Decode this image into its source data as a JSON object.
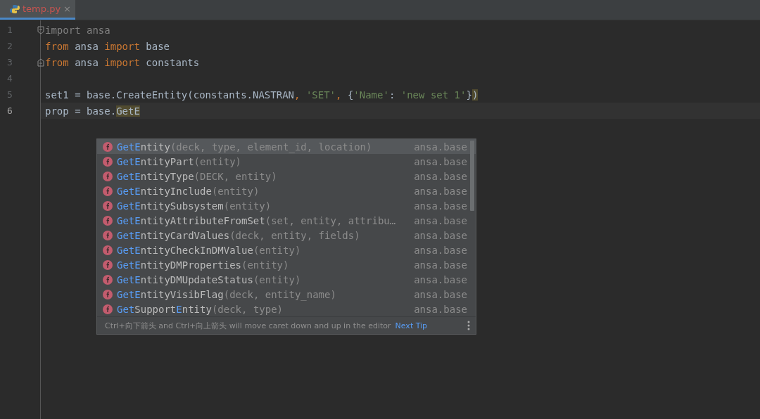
{
  "tabs": [
    {
      "label": "temp.py",
      "close": "×",
      "selected": true
    }
  ],
  "editor": {
    "lines": [
      {
        "number": "1",
        "current": false,
        "fold_start": true,
        "fold_end": false,
        "tokens": [
          {
            "text": "import ansa",
            "kind": "unused"
          }
        ]
      },
      {
        "number": "2",
        "current": false,
        "fold_start": false,
        "fold_end": false,
        "tokens": [
          {
            "text": "from",
            "kind": "keyword"
          },
          {
            "text": " ansa ",
            "kind": "plain"
          },
          {
            "text": "import",
            "kind": "keyword"
          },
          {
            "text": " base",
            "kind": "plain"
          }
        ]
      },
      {
        "number": "3",
        "current": false,
        "fold_start": false,
        "fold_end": true,
        "tokens": [
          {
            "text": "from",
            "kind": "keyword"
          },
          {
            "text": " ansa ",
            "kind": "plain"
          },
          {
            "text": "import",
            "kind": "keyword"
          },
          {
            "text": " constants",
            "kind": "plain"
          }
        ]
      },
      {
        "number": "4",
        "current": false,
        "fold_start": false,
        "fold_end": false
      },
      {
        "number": "5",
        "current": false,
        "fold_start": false,
        "fold_end": false,
        "tokens": [
          {
            "text": "set1 = base.CreateEntity(constants.NASTRAN",
            "kind": "plain"
          },
          {
            "text": ", ",
            "kind": "keyword"
          },
          {
            "text": "'SET'",
            "kind": "string"
          },
          {
            "text": ", ",
            "kind": "keyword"
          },
          {
            "text": "{",
            "kind": "plain"
          },
          {
            "text": "'Name'",
            "kind": "string"
          },
          {
            "text": ": ",
            "kind": "plain"
          },
          {
            "text": "'new set 1'",
            "kind": "string"
          },
          {
            "text": "}",
            "kind": "plain"
          },
          {
            "text": ")",
            "kind": "plain",
            "highlight": true
          }
        ]
      },
      {
        "number": "6",
        "current": true,
        "fold_start": false,
        "fold_end": false,
        "tokens": [
          {
            "text": "prop = base.",
            "kind": "plain"
          },
          {
            "text": "GetE",
            "kind": "plain",
            "highlight": true
          }
        ]
      }
    ]
  },
  "completion": {
    "items": [
      {
        "selected": true,
        "name_parts": [
          {
            "text": "GetE",
            "match": true
          },
          {
            "text": "ntity",
            "match": false
          }
        ],
        "params": "(deck, type, element_id, location)",
        "module": "ansa.base"
      },
      {
        "selected": false,
        "name_parts": [
          {
            "text": "GetE",
            "match": true
          },
          {
            "text": "ntityPart",
            "match": false
          }
        ],
        "params": "(entity)",
        "module": "ansa.base"
      },
      {
        "selected": false,
        "name_parts": [
          {
            "text": "GetE",
            "match": true
          },
          {
            "text": "ntityType",
            "match": false
          }
        ],
        "params": "(DECK, entity)",
        "module": "ansa.base"
      },
      {
        "selected": false,
        "name_parts": [
          {
            "text": "GetE",
            "match": true
          },
          {
            "text": "ntityInclude",
            "match": false
          }
        ],
        "params": "(entity)",
        "module": "ansa.base"
      },
      {
        "selected": false,
        "name_parts": [
          {
            "text": "GetE",
            "match": true
          },
          {
            "text": "ntitySubsystem",
            "match": false
          }
        ],
        "params": "(entity)",
        "module": "ansa.base"
      },
      {
        "selected": false,
        "name_parts": [
          {
            "text": "GetE",
            "match": true
          },
          {
            "text": "ntityAttributeFromSet",
            "match": false
          }
        ],
        "params": "(set, entity, attribu…",
        "module": "ansa.base"
      },
      {
        "selected": false,
        "name_parts": [
          {
            "text": "GetE",
            "match": true
          },
          {
            "text": "ntityCardValues",
            "match": false
          }
        ],
        "params": "(deck, entity, fields)",
        "module": "ansa.base"
      },
      {
        "selected": false,
        "name_parts": [
          {
            "text": "GetE",
            "match": true
          },
          {
            "text": "ntityCheckInDMValue",
            "match": false
          }
        ],
        "params": "(entity)",
        "module": "ansa.base"
      },
      {
        "selected": false,
        "name_parts": [
          {
            "text": "GetE",
            "match": true
          },
          {
            "text": "ntityDMProperties",
            "match": false
          }
        ],
        "params": "(entity)",
        "module": "ansa.base"
      },
      {
        "selected": false,
        "name_parts": [
          {
            "text": "GetE",
            "match": true
          },
          {
            "text": "ntityDMUpdateStatus",
            "match": false
          }
        ],
        "params": "(entity)",
        "module": "ansa.base"
      },
      {
        "selected": false,
        "name_parts": [
          {
            "text": "GetE",
            "match": true
          },
          {
            "text": "ntityVisibFlag",
            "match": false
          }
        ],
        "params": "(deck, entity_name)",
        "module": "ansa.base"
      },
      {
        "selected": false,
        "name_parts": [
          {
            "text": "Get",
            "match": true
          },
          {
            "text": "Support",
            "match": false
          },
          {
            "text": "E",
            "match": true
          },
          {
            "text": "ntity",
            "match": false
          }
        ],
        "params": "(deck, type)",
        "module": "ansa.base"
      }
    ],
    "tip": "Ctrl+向下箭头 and Ctrl+向上箭头 will move caret down and up in the editor",
    "tip_link": "Next Tip"
  }
}
